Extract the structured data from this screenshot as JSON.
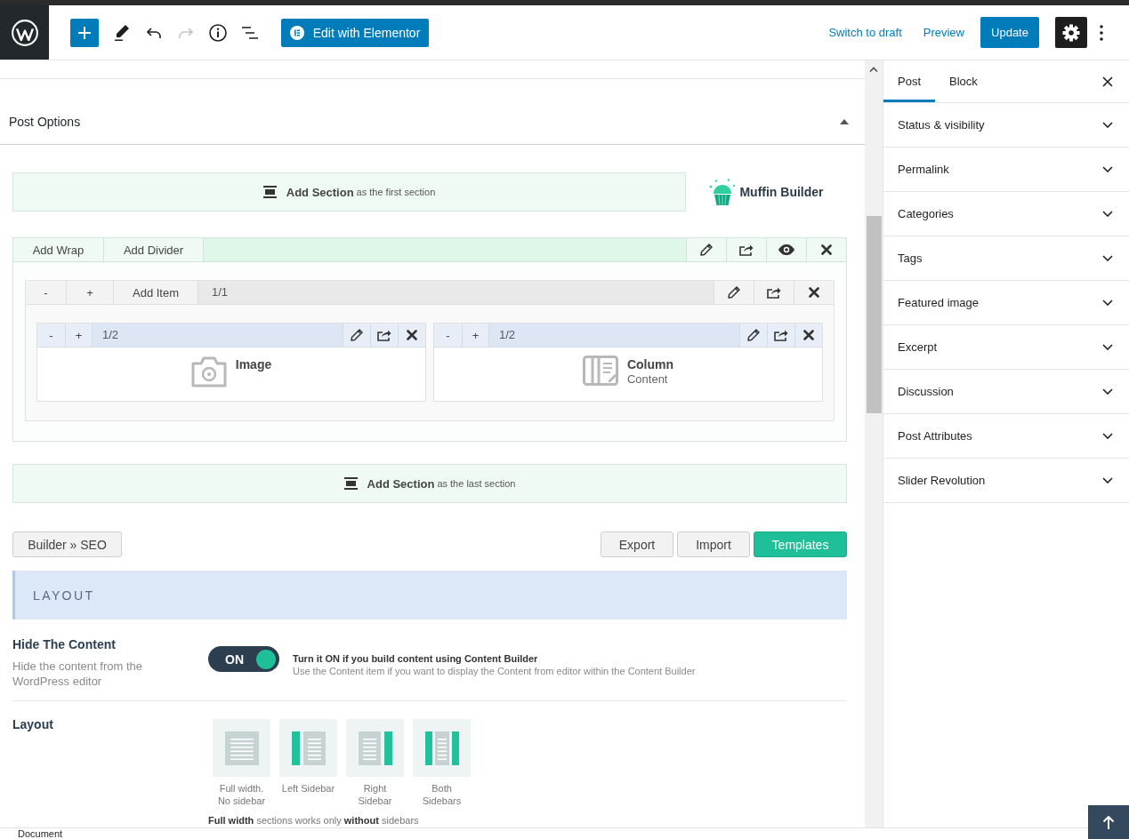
{
  "header": {
    "tools": [
      {
        "kind": "add",
        "disabled": false
      },
      {
        "kind": "edit",
        "disabled": false
      },
      {
        "kind": "undo",
        "disabled": false
      },
      {
        "kind": "redo",
        "disabled": true
      },
      {
        "kind": "info",
        "disabled": false
      },
      {
        "kind": "outline",
        "disabled": false
      }
    ],
    "elementor_button": "Edit with Elementor",
    "links": [
      "Switch to draft",
      "Preview"
    ],
    "update_button": "Update",
    "settings_pressed": true
  },
  "post_options": {
    "title": "Post Options",
    "expanded": true
  },
  "builder": {
    "add_section_top": {
      "label": "Add Section",
      "hint": "as the first section"
    },
    "logo_text": "Muffin Builder",
    "section": {
      "actions": [
        "Add Wrap",
        "Add Divider"
      ],
      "wrap": {
        "controls": [
          "-",
          "+"
        ],
        "add_item": "Add Item",
        "size": "1/1",
        "items": [
          {
            "kind": "image",
            "controls": [
              "-",
              "+"
            ],
            "size": "1/2",
            "title": "Image"
          },
          {
            "kind": "column",
            "controls": [
              "-",
              "+"
            ],
            "size": "1/2",
            "title": "Column",
            "subtitle": "Content"
          }
        ]
      }
    },
    "add_section_bottom": {
      "label": "Add Section",
      "hint": "as the last section"
    }
  },
  "actions": {
    "left": "Builder » SEO",
    "right": [
      {
        "label": "Export",
        "kind": "plain"
      },
      {
        "label": "Import",
        "kind": "plain"
      },
      {
        "label": "Templates",
        "kind": "primary"
      }
    ]
  },
  "layout_panel": {
    "heading": "LAYOUT",
    "hide_content": {
      "title": "Hide The Content",
      "description": "Hide the content from the WordPress editor",
      "toggle": {
        "label": "ON",
        "on": true
      },
      "help_title": "Turn it ON if you build content using Content Builder",
      "help_text": "Use the Content item if you want to display the Content from editor within the Content Builder"
    },
    "layout": {
      "title": "Layout",
      "options": [
        {
          "kind": "full",
          "label": "Full width. No sidebar",
          "selected": false
        },
        {
          "kind": "left",
          "label": "Left Sidebar",
          "selected": false
        },
        {
          "kind": "right",
          "label": "Right Sidebar",
          "selected": false
        },
        {
          "kind": "both",
          "label": "Both Sidebars",
          "selected": false
        }
      ],
      "note": "**Full width** sections works only **without** sidebars"
    }
  },
  "sidebar": {
    "tabs": [
      {
        "label": "Post",
        "selected": true
      },
      {
        "label": "Block",
        "selected": false
      }
    ],
    "panels": [
      {
        "title": "Status & visibility",
        "expanded": false
      },
      {
        "title": "Permalink",
        "expanded": false
      },
      {
        "title": "Categories",
        "expanded": false
      },
      {
        "title": "Tags",
        "expanded": false
      },
      {
        "title": "Featured image",
        "expanded": false
      },
      {
        "title": "Excerpt",
        "expanded": false
      },
      {
        "title": "Discussion",
        "expanded": false
      },
      {
        "title": "Post Attributes",
        "expanded": false
      },
      {
        "title": "Slider Revolution",
        "expanded": false
      }
    ]
  },
  "footer": {
    "breadcrumb": "Document"
  }
}
